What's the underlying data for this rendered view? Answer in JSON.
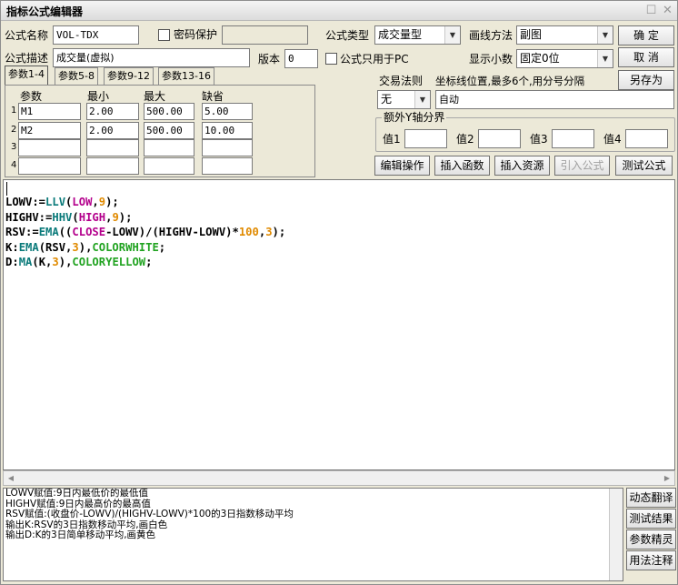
{
  "window": {
    "title": "指标公式编辑器"
  },
  "form": {
    "name_label": "公式名称",
    "name_value": "VOL-TDX",
    "password_label": "密码保护",
    "formula_type_label": "公式类型",
    "formula_type_value": "成交量型",
    "draw_method_label": "画线方法",
    "draw_method_value": "副图",
    "desc_label": "公式描述",
    "desc_value": "成交量(虚拟)",
    "version_label": "版本",
    "version_value": "0",
    "pc_only_label": "公式只用于PC",
    "decimals_label": "显示小数",
    "decimals_value": "固定0位"
  },
  "buttons": {
    "ok": "确  定",
    "cancel": "取  消",
    "save_as": "另存为",
    "edit_ops": "编辑操作",
    "insert_func": "插入函数",
    "insert_res": "插入资源",
    "import_formula": "引入公式",
    "test_formula": "测试公式",
    "dyn_translate": "动态翻译",
    "test_result": "测试结果",
    "param_wizard": "参数精灵",
    "usage_note": "用法注释"
  },
  "tabs": [
    "参数1-4",
    "参数5-8",
    "参数9-12",
    "参数13-16"
  ],
  "params": {
    "headers": {
      "name": "参数",
      "min": "最小",
      "max": "最大",
      "default": "缺省"
    },
    "rows": [
      {
        "num": "1",
        "name": "M1",
        "min": "2.00",
        "max": "500.00",
        "default": "5.00"
      },
      {
        "num": "2",
        "name": "M2",
        "min": "2.00",
        "max": "500.00",
        "default": "10.00"
      },
      {
        "num": "3",
        "name": "",
        "min": "",
        "max": "",
        "default": ""
      },
      {
        "num": "4",
        "name": "",
        "min": "",
        "max": "",
        "default": ""
      }
    ]
  },
  "trade": {
    "rule_label": "交易法则",
    "rule_value": "无",
    "axis_label": "坐标线位置,最多6个,用分号分隔",
    "axis_value": "自动",
    "extra_y_label": "额外Y轴分界",
    "v1": "值1",
    "v2": "值2",
    "v3": "值3",
    "v4": "值4"
  },
  "code": [
    [
      [
        "LOWV:=",
        "k"
      ],
      [
        "LLV",
        "b"
      ],
      [
        "(",
        "k"
      ],
      [
        "LOW",
        "m"
      ],
      [
        ",",
        "k"
      ],
      [
        "9",
        "o"
      ],
      [
        ");",
        "k"
      ]
    ],
    [
      [
        "HIGHV:=",
        "k"
      ],
      [
        "HHV",
        "b"
      ],
      [
        "(",
        "k"
      ],
      [
        "HIGH",
        "m"
      ],
      [
        ",",
        "k"
      ],
      [
        "9",
        "o"
      ],
      [
        ");",
        "k"
      ]
    ],
    [
      [
        "RSV:=",
        "k"
      ],
      [
        "EMA",
        "b"
      ],
      [
        "((",
        "k"
      ],
      [
        "CLOSE",
        "m"
      ],
      [
        "-LOWV)/(HIGHV-LOWV)*",
        "k"
      ],
      [
        "100",
        "o"
      ],
      [
        ",",
        "k"
      ],
      [
        "3",
        "o"
      ],
      [
        ");",
        "k"
      ]
    ],
    [
      [
        "K:",
        "k"
      ],
      [
        "EMA",
        "b"
      ],
      [
        "(RSV,",
        "k"
      ],
      [
        "3",
        "o"
      ],
      [
        "),",
        "k"
      ],
      [
        "COLORWHITE",
        "g"
      ],
      [
        ";",
        "k"
      ]
    ],
    [
      [
        "D:",
        "k"
      ],
      [
        "MA",
        "b"
      ],
      [
        "(K,",
        "k"
      ],
      [
        "3",
        "o"
      ],
      [
        "),",
        "k"
      ],
      [
        "COLORYELLOW",
        "g"
      ],
      [
        ";",
        "k"
      ]
    ]
  ],
  "notes": [
    "LOWV赋值:9日内最低价的最低值",
    "HIGHV赋值:9日内最高价的最高值",
    "RSV赋值:(收盘价-LOWV)/(HIGHV-LOWV)*100的3日指数移动平均",
    "输出K:RSV的3日指数移动平均,画白色",
    "输出D:K的3日简单移动平均,画黄色"
  ]
}
